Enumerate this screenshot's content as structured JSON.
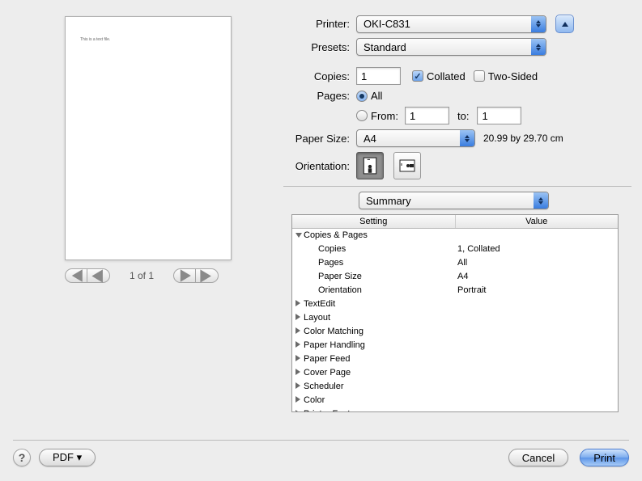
{
  "labels": {
    "printer": "Printer:",
    "presets": "Presets:",
    "copies": "Copies:",
    "collated": "Collated",
    "twoSided": "Two-Sided",
    "pages": "Pages:",
    "all": "All",
    "from": "From:",
    "to": "to:",
    "paperSize": "Paper Size:",
    "orientation": "Orientation:"
  },
  "printer": "OKI-C831",
  "preset": "Standard",
  "copies": "1",
  "pagesFrom": "1",
  "pagesTo": "1",
  "paperSize": "A4",
  "paperDims": "20.99 by 29.70 cm",
  "section": "Summary",
  "preview": {
    "text": "This is a text file.",
    "pageIndicator": "1 of 1"
  },
  "summary": {
    "headers": {
      "setting": "Setting",
      "value": "Value"
    },
    "groupExpanded": "Copies & Pages",
    "leaves": [
      {
        "k": "Copies",
        "v": "1, Collated"
      },
      {
        "k": "Pages",
        "v": "All"
      },
      {
        "k": "Paper Size",
        "v": "A4"
      },
      {
        "k": "Orientation",
        "v": "Portrait"
      }
    ],
    "collapsedGroups": [
      "TextEdit",
      "Layout",
      "Color Matching",
      "Paper Handling",
      "Paper Feed",
      "Cover Page",
      "Scheduler",
      "Color",
      "Printer Features"
    ]
  },
  "buttons": {
    "pdf": "PDF ▾",
    "cancel": "Cancel",
    "print": "Print",
    "help": "?"
  }
}
